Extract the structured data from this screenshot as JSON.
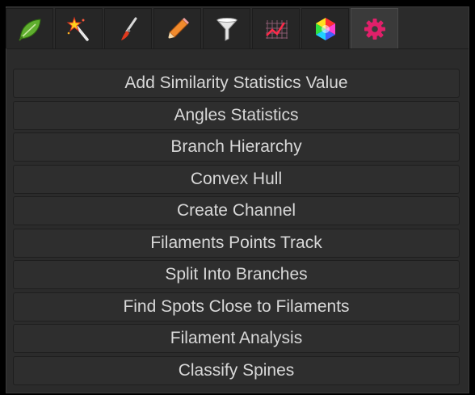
{
  "tabs": [
    {
      "icon": "leaf-icon",
      "active": false
    },
    {
      "icon": "magic-wand-icon",
      "active": false
    },
    {
      "icon": "paintbrush-icon",
      "active": false
    },
    {
      "icon": "pencil-icon",
      "active": false
    },
    {
      "icon": "filter-funnel-icon",
      "active": false
    },
    {
      "icon": "line-chart-icon",
      "active": false
    },
    {
      "icon": "color-wheel-icon",
      "active": false
    },
    {
      "icon": "gear-icon",
      "active": true
    }
  ],
  "buttons": [
    "Add Similarity Statistics Value",
    "Angles Statistics",
    "Branch Hierarchy",
    "Convex Hull",
    "Create Channel",
    "Filaments Points Track",
    "Split Into Branches",
    "Find Spots Close to Filaments",
    "Filament Analysis",
    "Classify Spines"
  ],
  "colors": {
    "background": "#000000",
    "panel": "#2b2b2b",
    "button_face": "#2e2e2e",
    "button_text": "#d8d8d8",
    "gear_accent": "#e0206a"
  }
}
